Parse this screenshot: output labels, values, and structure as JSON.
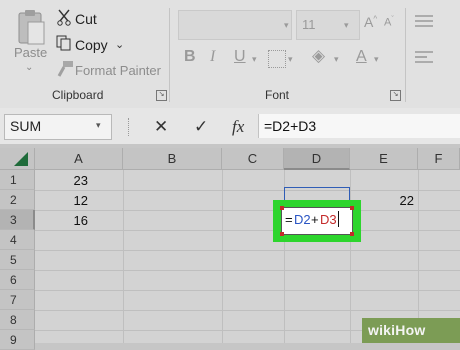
{
  "ribbon": {
    "clipboard": {
      "paste_label": "Paste",
      "cut_label": "Cut",
      "copy_label": "Copy",
      "format_painter_label": "Format Painter",
      "group_title": "Clipboard"
    },
    "font": {
      "font_size_value": "11",
      "group_title": "Font"
    }
  },
  "formula_bar": {
    "name_box_value": "SUM",
    "formula_value": "=D2+D3"
  },
  "grid": {
    "columns": [
      "A",
      "B",
      "C",
      "D",
      "E",
      "F"
    ],
    "rows": [
      "1",
      "2",
      "3",
      "4",
      "5",
      "6",
      "7",
      "8",
      "9"
    ],
    "cells": {
      "A1": "23",
      "A2": "12",
      "A3": "16",
      "E2": "22"
    },
    "editing_cell": {
      "eq": "=",
      "ref1": "D2",
      "plus": "+",
      "ref2": "D3"
    }
  },
  "colors": {
    "highlight_border": "#2dd52d",
    "ref1_color": "#2a55c4",
    "ref2_color": "#c42a2a"
  },
  "watermark": {
    "text": "wikiHow"
  }
}
